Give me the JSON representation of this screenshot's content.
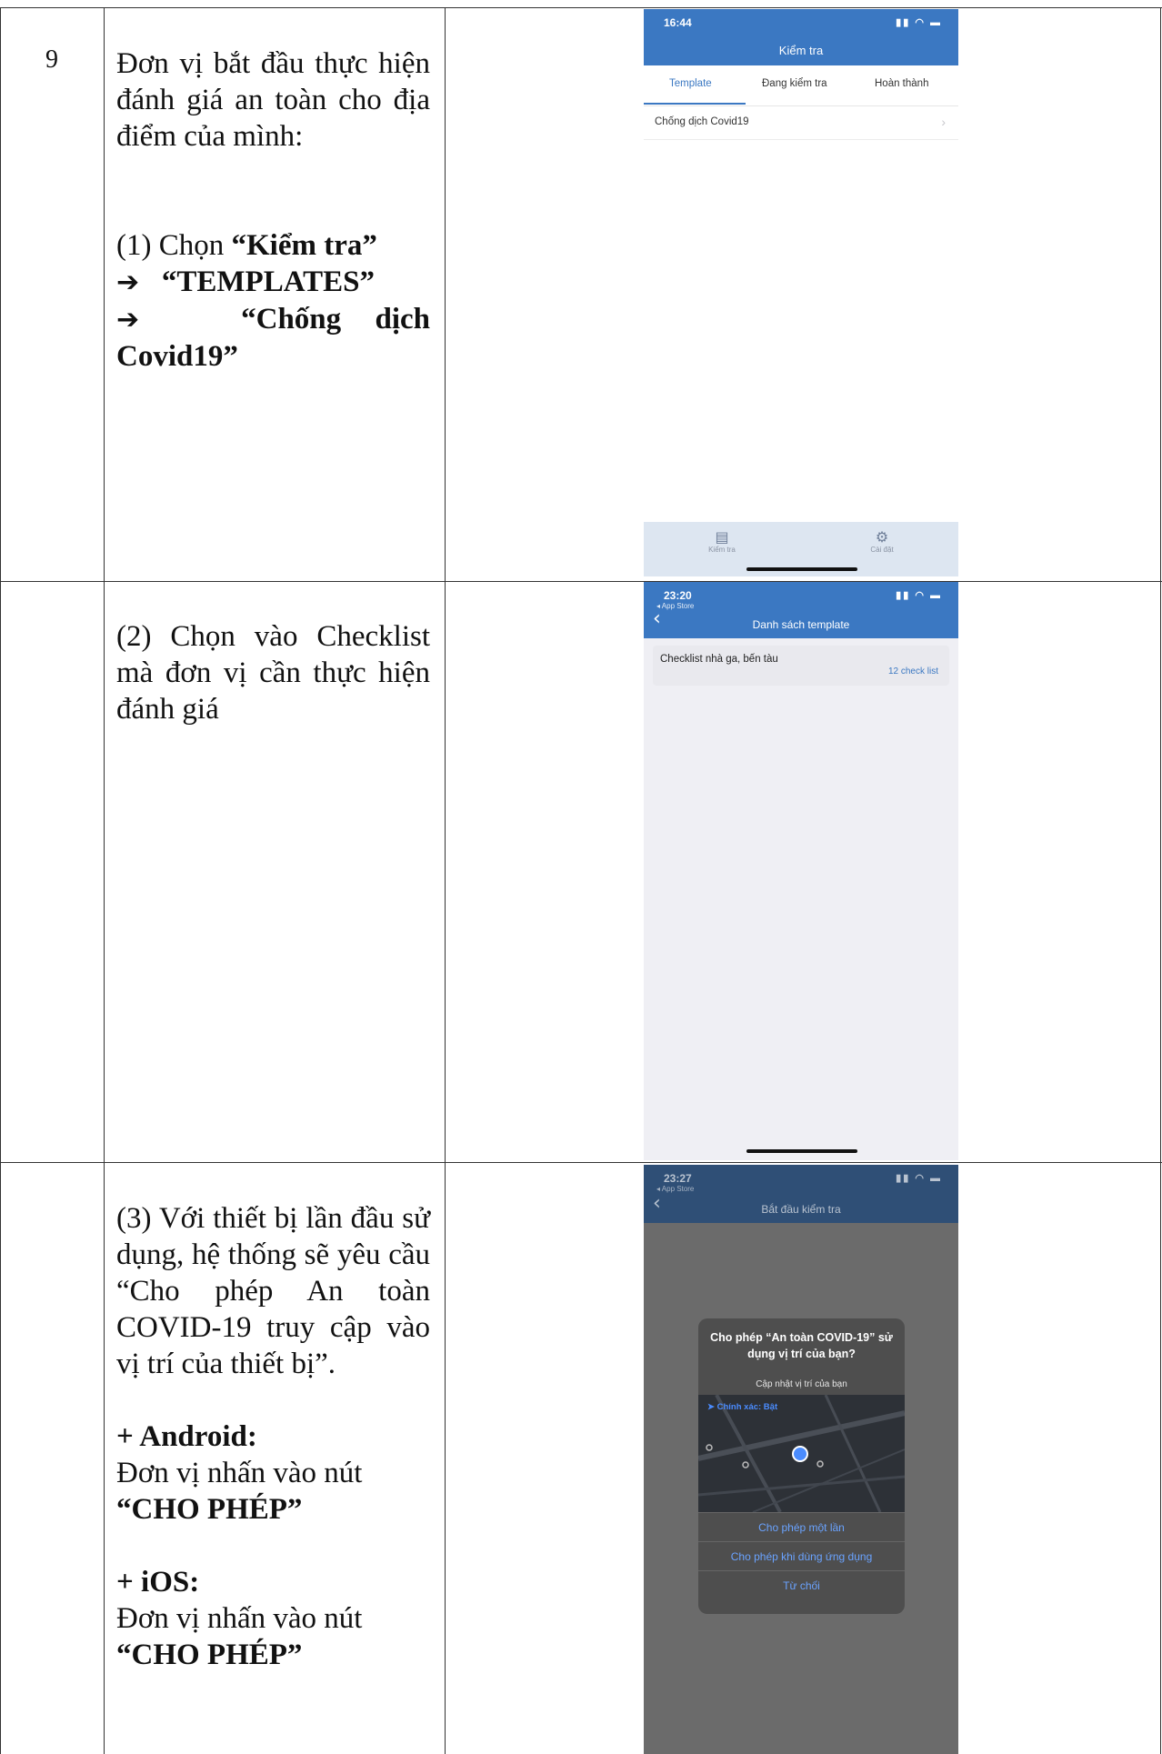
{
  "row_number": "9",
  "instructions": {
    "intro": "Đơn vị bắt đầu thực hiện đánh giá an toàn cho địa điểm của mình:",
    "step1_prefix": "(1) Chọn",
    "step1_kiemtra": "“Kiểm tra”",
    "step1_templates": "“TEMPLATES”",
    "step1_chongdich": "“Chống dịch Covid19”",
    "arrow": "➔",
    "step2": "(2) Chọn vào Checklist mà đơn vị cần thực hiện đánh giá",
    "step3": "(3) Với thiết bị lần đầu sử dụng, hệ thống sẽ yêu cầu “Cho phép An toàn COVID-19 truy cập vào vị trí của thiết bị”.",
    "android_title": "+ Android:",
    "android_text": "Đơn vị nhấn vào nút",
    "android_btn": "“CHO PHÉP”",
    "ios_title": "+ iOS:",
    "ios_text": "Đơn vị nhấn vào nút",
    "ios_btn": "“CHO PHÉP”"
  },
  "screen1": {
    "time": "16:44",
    "title": "Kiểm tra",
    "tabs": [
      "Template",
      "Đang kiểm tra",
      "Hoàn thành"
    ],
    "item": "Chống dịch Covid19",
    "tabbar": [
      {
        "icon": "clipboard-icon",
        "label": "Kiểm tra"
      },
      {
        "icon": "gear-icon",
        "label": "Cài đặt"
      }
    ]
  },
  "screen2": {
    "time": "23:20",
    "back_app": "◂ App Store",
    "title": "Danh sách template",
    "card_title": "Checklist nhà ga, bến tàu",
    "card_count": "12 check list"
  },
  "screen3": {
    "time": "23:27",
    "back_app": "◂ App Store",
    "title": "Bắt đầu kiểm tra",
    "dialog_title": "Cho phép “An toàn COVID-19” sử dụng vị trí của bạn?",
    "dialog_sub": "Cập nhật vị trí của bạn",
    "precise": "Chính xác: Bật",
    "options": [
      "Cho phép một lần",
      "Cho phép khi dùng ứng dụng",
      "Từ chối"
    ]
  },
  "colors": {
    "accent": "#3b78c2",
    "ios_link": "#6aa3ff"
  }
}
